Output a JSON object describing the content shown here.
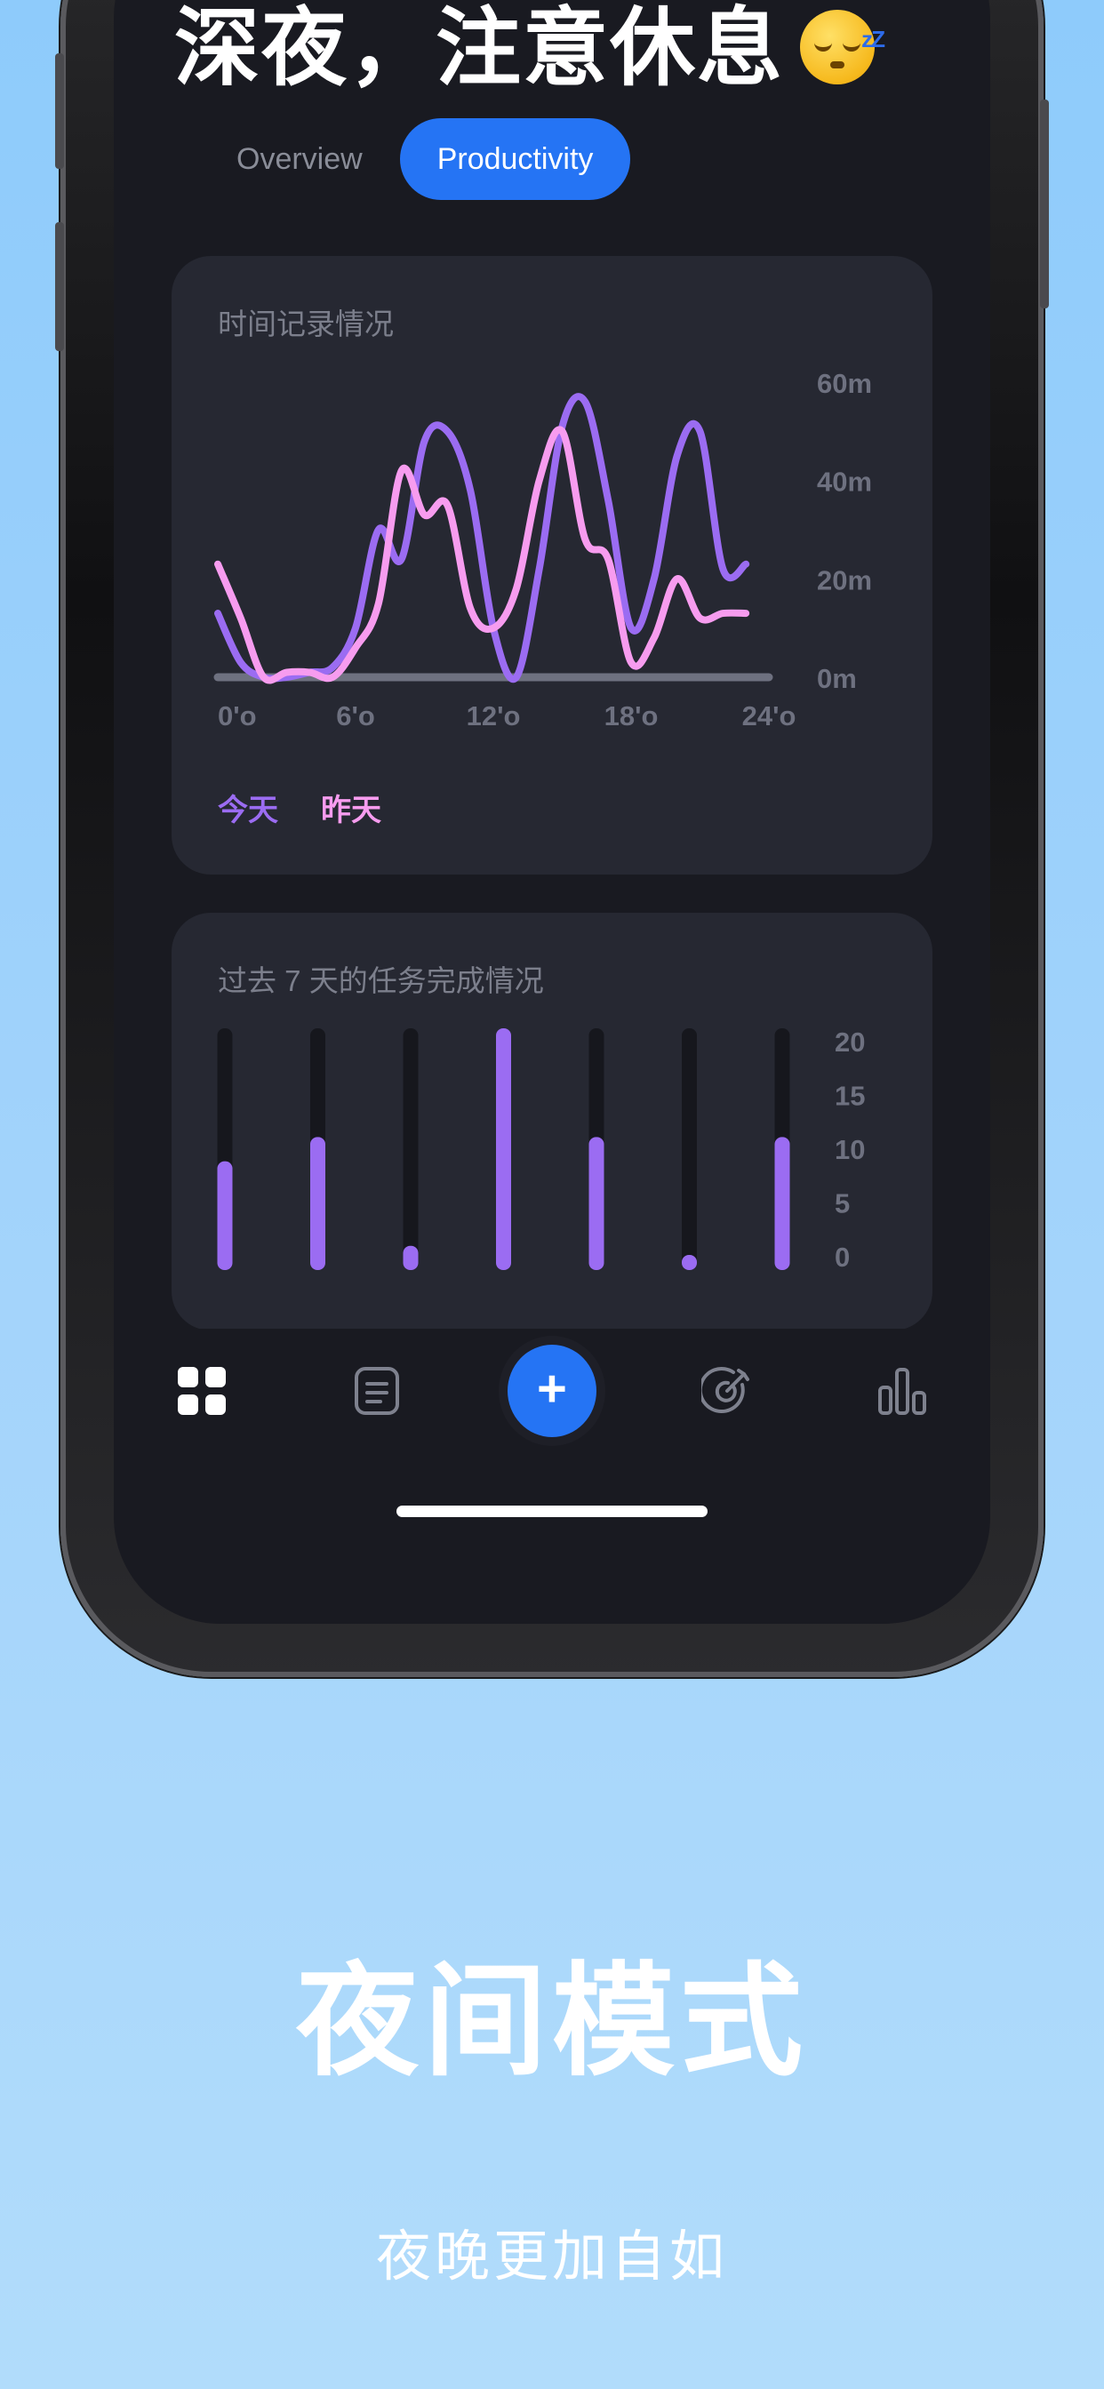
{
  "header": {
    "greeting": "深夜，注意休息",
    "emoji": "sleeping-face-emoji",
    "emoji_zzz": "zZ"
  },
  "tabs": [
    {
      "label": "Overview",
      "active": false
    },
    {
      "label": "Productivity",
      "active": true
    }
  ],
  "time_card": {
    "title": "时间记录情况",
    "legend": [
      {
        "label": "今天",
        "color": "#9B6CF2"
      },
      {
        "label": "昨天",
        "color": "#F79CEF"
      }
    ]
  },
  "tasks_card": {
    "title": "过去 7 天的任务完成情况"
  },
  "chart_data": [
    {
      "type": "line",
      "title": "时间记录情况",
      "x_ticks": [
        "0'o",
        "6'o",
        "12'o",
        "18'o",
        "24'o"
      ],
      "y_ticks": [
        "0m",
        "20m",
        "40m",
        "60m"
      ],
      "ylim": [
        0,
        60
      ],
      "xlim": [
        0,
        24
      ],
      "grid": false,
      "legend_position": "bottom-left",
      "series": [
        {
          "name": "今天",
          "color": "#9B6CF2",
          "x": [
            0,
            1,
            2,
            3,
            4,
            5,
            6,
            7,
            8,
            9,
            10,
            11,
            12,
            13,
            14,
            15,
            16,
            17,
            18,
            19,
            20,
            21,
            22,
            23
          ],
          "values": [
            13,
            3,
            0,
            0,
            1,
            2,
            10,
            30,
            24,
            48,
            50,
            38,
            10,
            0,
            22,
            51,
            56,
            36,
            10,
            20,
            45,
            50,
            22,
            23
          ]
        },
        {
          "name": "昨天",
          "color": "#F79CEF",
          "x": [
            0,
            1,
            2,
            3,
            4,
            5,
            6,
            7,
            8,
            9,
            10,
            11,
            12,
            13,
            14,
            15,
            16,
            17,
            18,
            19,
            20,
            21,
            22,
            23
          ],
          "values": [
            23,
            12,
            0,
            1,
            1,
            0,
            6,
            15,
            42,
            33,
            35,
            14,
            10,
            18,
            40,
            50,
            28,
            24,
            3,
            8,
            20,
            12,
            13,
            13
          ]
        }
      ]
    },
    {
      "type": "bar",
      "title": "过去 7 天的任务完成情况",
      "categories": [
        "1",
        "2",
        "3",
        "4",
        "5",
        "6",
        "7"
      ],
      "values": [
        9,
        11,
        2,
        20,
        11,
        1,
        11
      ],
      "y_ticks": [
        "20",
        "15",
        "10",
        "5",
        "0"
      ],
      "ylim": [
        0,
        20
      ],
      "bar_color": "#9B6CF2",
      "track_color": "#16171D"
    }
  ],
  "nav": {
    "items": [
      {
        "name": "dashboard-grid-icon",
        "active": true
      },
      {
        "name": "notes-list-icon",
        "active": false
      },
      {
        "name": "add-button",
        "label": "+",
        "active": false
      },
      {
        "name": "target-goal-icon",
        "active": false
      },
      {
        "name": "statistics-bars-icon",
        "active": false
      }
    ]
  },
  "promo": {
    "headline": "夜间模式",
    "subtitle": "夜晚更加自如"
  }
}
